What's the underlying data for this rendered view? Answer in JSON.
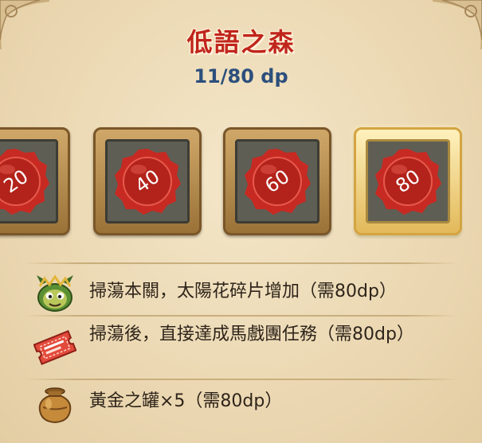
{
  "header": {
    "title": "低語之森",
    "points": "11/80 dp"
  },
  "milestones": [
    {
      "label": "20",
      "highlighted": false
    },
    {
      "label": "40",
      "highlighted": false
    },
    {
      "label": "60",
      "highlighted": false
    },
    {
      "label": "80",
      "highlighted": true
    }
  ],
  "rewards": [
    {
      "icon": "sunflower-creature-icon",
      "text": "掃蕩本關，太陽花碎片增加（需80dp）"
    },
    {
      "icon": "ticket-icon",
      "text": "掃蕩後，直接達成馬戲團任務（需80dp）"
    },
    {
      "icon": "golden-jar-icon",
      "text": "黃金之罐×5（需80dp）"
    }
  ],
  "colors": {
    "title": "#c0251c",
    "points": "#2c4f7c",
    "seal": "#c72a22",
    "parchment": "#f0e1c0"
  }
}
